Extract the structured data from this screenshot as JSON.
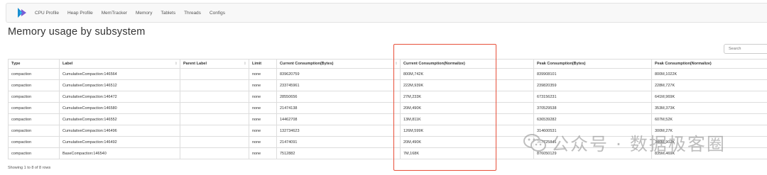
{
  "nav": {
    "items": [
      "CPU Profile",
      "Heap Profile",
      "MemTracker",
      "Memory",
      "Tablets",
      "Threads",
      "Configs"
    ]
  },
  "page": {
    "title": "Memory usage by subsystem"
  },
  "search": {
    "placeholder": "Search"
  },
  "table": {
    "columns": [
      "Type",
      "Label",
      "Parent Label",
      "Limit",
      "Current Consumption(Bytes)",
      "Current Consumption(Normalize)",
      "Peak Consumption(Bytes)",
      "Peak Consumption(Normalize)"
    ],
    "rows": [
      [
        "compaction",
        "CumulativeCompaction:146564",
        "",
        "none",
        "839620759",
        "800M,742K",
        "839908101",
        "800M,1022K"
      ],
      [
        "compaction",
        "CumulativeCompaction:146512",
        "",
        "none",
        "233745961",
        "222M,939K",
        "239820359",
        "228M,727K"
      ],
      [
        "compaction",
        "CumulativeCompaction:146472",
        "",
        "none",
        "28550656",
        "27M,233K",
        "673156231",
        "641M,969K"
      ],
      [
        "compaction",
        "CumulativeCompaction:146580",
        "",
        "none",
        "21474138",
        "20M,490K",
        "370529538",
        "353M,373K"
      ],
      [
        "compaction",
        "CumulativeCompaction:146552",
        "",
        "none",
        "14462708",
        "13M,811K",
        "636539282",
        "607M,52K"
      ],
      [
        "compaction",
        "CumulativeCompaction:146496",
        "",
        "none",
        "132734623",
        "126M,599K",
        "314600531",
        "300M,27K"
      ],
      [
        "compaction",
        "CumulativeCompaction:146492",
        "",
        "none",
        "21474091",
        "20M,490K",
        "363725841",
        "346M,902K"
      ],
      [
        "compaction",
        "BaseCompaction:146540",
        "",
        "none",
        "7512882",
        "7M,168K",
        "876050129",
        "835M,469K"
      ]
    ]
  },
  "footer": {
    "text": "Showing 1 to 8 of 8 rows"
  },
  "watermark": {
    "text": "公众号 · 数据极客圈"
  },
  "colors": {
    "highlight": "#e8503a",
    "logo_primary": "#1a8fd1",
    "logo_secondary": "#6a4bd0"
  }
}
